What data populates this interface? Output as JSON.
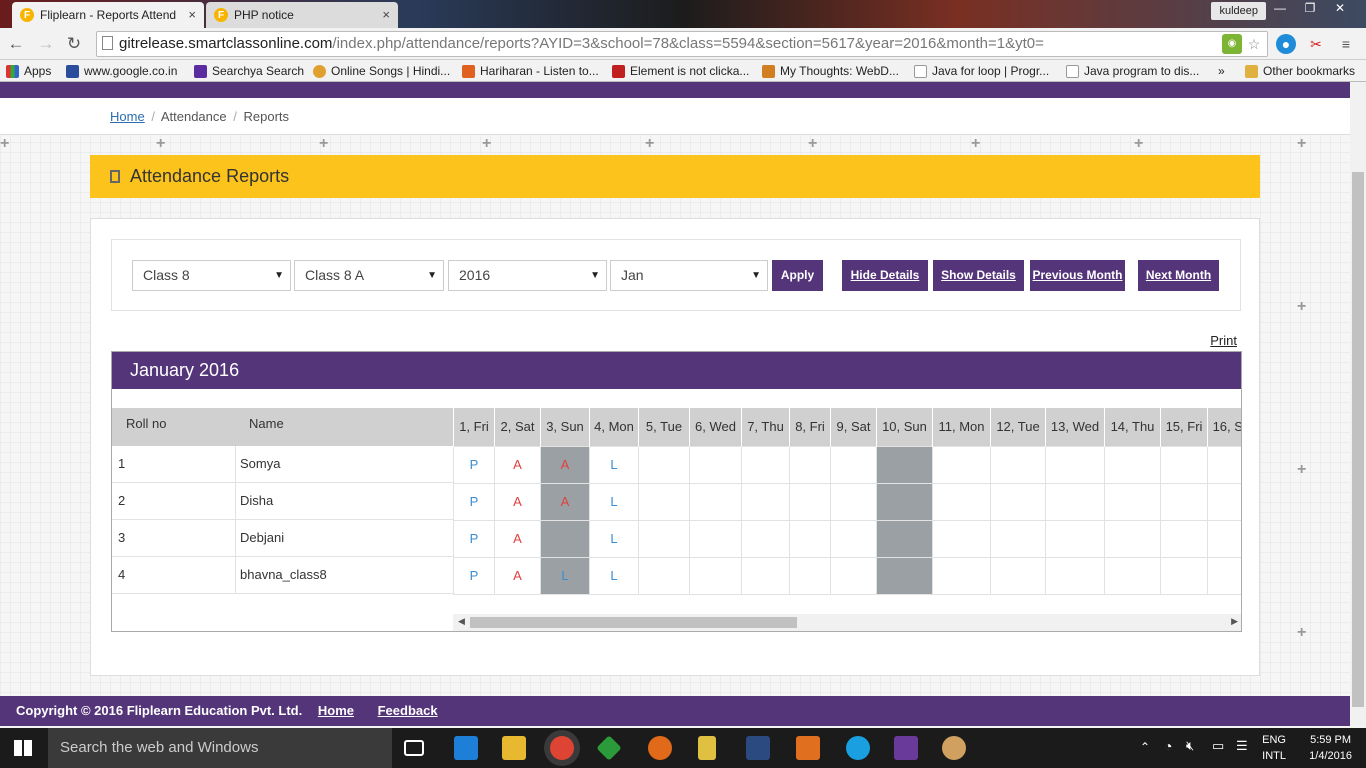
{
  "browser": {
    "tabs": [
      {
        "title": "Fliplearn - Reports Attend",
        "fav": "F"
      },
      {
        "title": "PHP notice",
        "fav": "F"
      }
    ],
    "user": "kuldeep",
    "url_host": "gitrelease.smartclassonline.com",
    "url_path": "/index.php/attendance/reports?AYID=3&school=78&class=5594&section=5617&year=2016&month=1&yt0=",
    "bookmarks": [
      "Apps",
      "www.google.co.in",
      "Searchya Search",
      "Online Songs | Hindi...",
      "Hariharan - Listen to...",
      "Element is not clicka...",
      "My Thoughts: WebD...",
      "Java for loop | Progr...",
      "Java program to dis...",
      "Other bookmarks"
    ],
    "bookmarks_more": "»"
  },
  "breadcrumb": {
    "home": "Home",
    "sep": "/",
    "section": "Attendance",
    "page": "Reports"
  },
  "panel": {
    "title": "Attendance Reports"
  },
  "filters": {
    "class": "Class 8",
    "section": "Class 8 A",
    "year": "2016",
    "month": "Jan",
    "apply": "Apply",
    "hide_details": "Hide Details",
    "show_details": "Show Details",
    "previous_month": "Previous Month",
    "next_month": "Next Month"
  },
  "print": "Print",
  "report": {
    "heading": "January 2016",
    "col_roll": "Roll no",
    "col_name": "Name",
    "days": [
      "1, Fri",
      "2, Sat",
      "3, Sun",
      "4, Mon",
      "5, Tue",
      "6, Wed",
      "7, Thu",
      "8, Fri",
      "9, Sat",
      "10, Sun",
      "11, Mon",
      "12, Tue",
      "13, Wed",
      "14, Thu",
      "15, Fri",
      "16, S"
    ],
    "rows": [
      {
        "roll": "1",
        "name": "Somya",
        "marks": [
          "P",
          "A",
          "A",
          "L"
        ]
      },
      {
        "roll": "2",
        "name": "Disha",
        "marks": [
          "P",
          "A",
          "A",
          "L"
        ]
      },
      {
        "roll": "3",
        "name": "Debjani",
        "marks": [
          "P",
          "A",
          "",
          "L"
        ]
      },
      {
        "roll": "4",
        "name": "bhavna_class8",
        "marks": [
          "P",
          "A",
          "L",
          "L"
        ]
      }
    ]
  },
  "footer": {
    "copyright": "Copyright © 2016 Fliplearn Education Pvt. Ltd.",
    "home": "Home",
    "feedback": "Feedback"
  },
  "taskbar": {
    "search": "Search the web and Windows",
    "lang1": "ENG",
    "lang2": "INTL",
    "time": "5:59 PM",
    "date": "1/4/2016"
  },
  "colors": {
    "purple": "#55357a",
    "yellow": "#fbc31c",
    "present": "#3a8dd0",
    "absent": "#e04040",
    "sunday": "#9aa0a4"
  }
}
